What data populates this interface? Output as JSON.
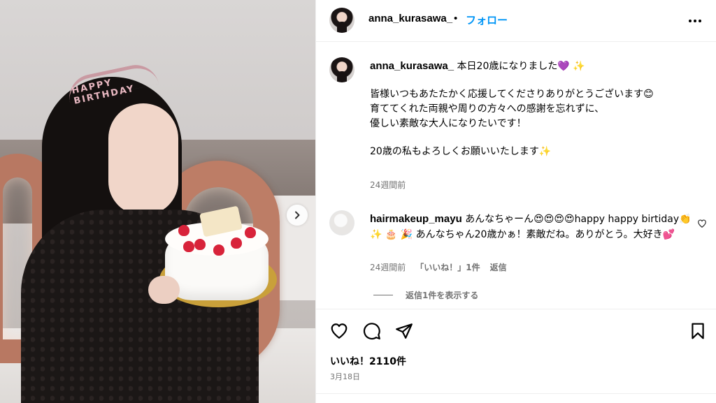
{
  "post": {
    "headband_text": "HAPPY BIRTHDAY",
    "next_icon": "chevron-right-icon"
  },
  "header": {
    "username": "anna_kurasawa_",
    "separator": "•",
    "follow_label": "フォロー",
    "more_icon": "more-horizontal-icon"
  },
  "caption": {
    "username": "anna_kurasawa_",
    "line1": "本日20歳になりました💜 ✨",
    "line2": "皆様いつもあたたかく応援してくださりありがとうございます😊",
    "line3": "育ててくれた両親や周りの方々への感謝を忘れずに、",
    "line4": "優しい素敵な大人になりたいです！",
    "line5": "20歳の私もよろしくお願いいたします✨",
    "time": "24週間前"
  },
  "comment": {
    "username": "hairmakeup_mayu",
    "text": "あんなちゃーん😍😍😍😍happy happy birtiday👏 ✨ 🎂 🎉 あんなちゃん20歳かぁ！素敵だね。ありがとう。大好き💕",
    "time": "24週間前",
    "likes": "「いいね！」1件",
    "reply_label": "返信",
    "view_replies": "返信1件を表示する"
  },
  "actions": {
    "like_icon": "heart-icon",
    "comment_icon": "comment-icon",
    "share_icon": "send-icon",
    "save_icon": "bookmark-icon"
  },
  "likes_text": "いいね！2110件",
  "date": "3月18日",
  "colors": {
    "accent": "#0095f6",
    "secondary_text": "#737373",
    "divider": "#efefef"
  }
}
